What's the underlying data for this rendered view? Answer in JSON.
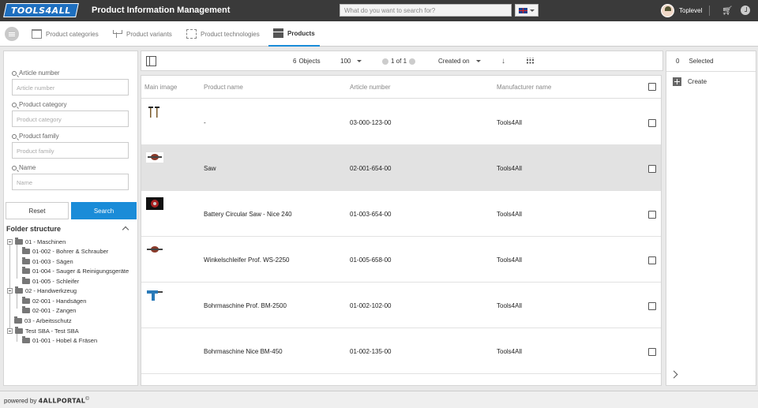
{
  "header": {
    "logo_text": "TOOLS4ALL",
    "app_title": "Product Information Management",
    "search_placeholder": "What do you want to search for?",
    "language": "en-GB",
    "username": "Toplevel"
  },
  "nav": {
    "tabs": [
      {
        "label": "Product categories",
        "icon": "categories-icon",
        "active": false
      },
      {
        "label": "Product variants",
        "icon": "variants-icon",
        "active": false
      },
      {
        "label": "Product technologies",
        "icon": "technologies-icon",
        "active": false
      },
      {
        "label": "Products",
        "icon": "products-icon",
        "active": true
      }
    ]
  },
  "filters": {
    "fields": [
      {
        "label": "Article number",
        "placeholder": "Article number"
      },
      {
        "label": "Product category",
        "placeholder": "Product category"
      },
      {
        "label": "Product family",
        "placeholder": "Product family"
      },
      {
        "label": "Name",
        "placeholder": "Name"
      }
    ],
    "reset_label": "Reset",
    "search_label": "Search"
  },
  "folder": {
    "title": "Folder structure",
    "items": [
      {
        "label": "01 - Maschinen",
        "level": 0,
        "expandable": true
      },
      {
        "label": "01-002 - Bohrer & Schrauber",
        "level": 1
      },
      {
        "label": "01-003 - Sägen",
        "level": 1
      },
      {
        "label": "01-004 - Sauger & Reinigungsgeräte",
        "level": 1
      },
      {
        "label": "01-005 - Schleifer",
        "level": 1
      },
      {
        "label": "02 - Handwerkzeug",
        "level": 0,
        "expandable": true
      },
      {
        "label": "02-001 - Handsägen",
        "level": 1
      },
      {
        "label": "02-001 - Zangen",
        "level": 1
      },
      {
        "label": "03 - Arbeitsschutz",
        "level": 0,
        "expandable": false
      },
      {
        "label": "Test SBA - Test SBA",
        "level": 0,
        "expandable": true
      },
      {
        "label": "01-001 - Hobel & Fräsen",
        "level": 1
      }
    ]
  },
  "toolbar": {
    "objects_count": "6",
    "objects_label": "Objects",
    "page_size": "100",
    "pagination": "1 of 1",
    "sort_label": "Created on"
  },
  "table": {
    "columns": [
      "Main image",
      "Product name",
      "Article number",
      "Manufacturer name"
    ],
    "rows": [
      {
        "name": "-",
        "article": "03-000-123-00",
        "manufacturer": "Tools4All",
        "image": "hammers",
        "selected": false
      },
      {
        "name": "Saw",
        "article": "02-001-654-00",
        "manufacturer": "Tools4All",
        "image": "saw",
        "selected": true
      },
      {
        "name": "Battery Circular Saw - Nice 240",
        "article": "01-003-654-00",
        "manufacturer": "Tools4All",
        "image": "circular-saw",
        "selected": false
      },
      {
        "name": "Winkelschleifer Prof. WS-2250",
        "article": "01-005-658-00",
        "manufacturer": "Tools4All",
        "image": "angle-grinder",
        "selected": false
      },
      {
        "name": "Bohrmaschine Prof. BM-2500",
        "article": "01-002-102-00",
        "manufacturer": "Tools4All",
        "image": "drill",
        "selected": false
      },
      {
        "name": "Bohrmaschine Nice BM-450",
        "article": "01-002-135-00",
        "manufacturer": "Tools4All",
        "image": "none",
        "selected": false
      }
    ]
  },
  "right_panel": {
    "selected_count": "0",
    "selected_label": "Selected",
    "create_label": "Create"
  },
  "footer": {
    "prefix": "powered by",
    "brand": "4ALLPORTAL",
    "mark": "©"
  },
  "colors": {
    "topbar": "#3a3a3a",
    "accent": "#1a8cd8",
    "selected_row": "#e2e2e2"
  }
}
